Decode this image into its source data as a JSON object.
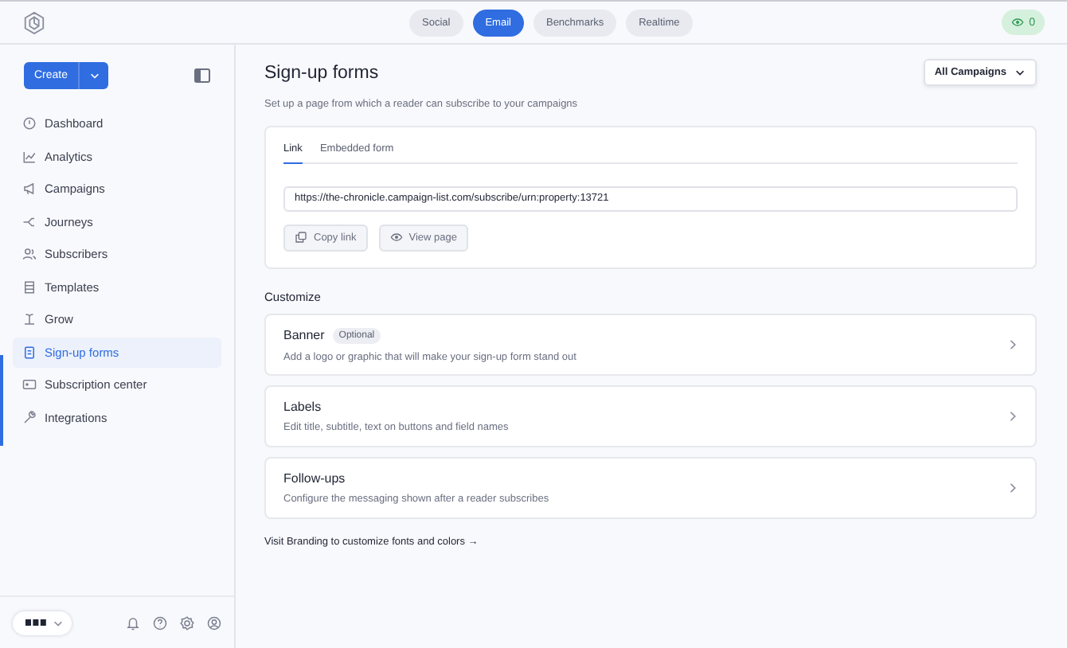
{
  "top_nav": {
    "tabs": [
      {
        "label": "Social",
        "selected": false
      },
      {
        "label": "Email",
        "selected": true
      },
      {
        "label": "Benchmarks",
        "selected": false
      },
      {
        "label": "Realtime",
        "selected": false
      }
    ],
    "views_count": "0"
  },
  "sidebar": {
    "create_button": "Create",
    "items": [
      {
        "label": "Dashboard",
        "selected": false
      },
      {
        "label": "Analytics",
        "selected": false
      },
      {
        "label": "Campaigns",
        "selected": false
      },
      {
        "label": "Journeys",
        "selected": false
      },
      {
        "label": "Subscribers",
        "selected": false
      },
      {
        "label": "Templates",
        "selected": false
      },
      {
        "label": "Grow",
        "selected": false
      },
      {
        "label": "Sign-up forms",
        "selected": true
      },
      {
        "label": "Subscription center",
        "selected": false
      },
      {
        "label": "Integrations",
        "selected": false
      }
    ]
  },
  "main": {
    "title": "Sign-up forms",
    "subtitle": "Set up a page from which a reader can subscribe to your campaigns",
    "filter": "All Campaigns",
    "tabs": [
      {
        "label": "Link",
        "selected": true
      },
      {
        "label": "Embedded form",
        "selected": false
      }
    ],
    "url": "https://the-chronicle.campaign-list.com/subscribe/urn:property:13721",
    "actions": [
      "Copy link",
      "View page"
    ],
    "section_title": "Customize",
    "cards": [
      {
        "title": "Banner",
        "badge": "Optional",
        "description": "Add a logo or graphic that will make your sign-up form stand out"
      },
      {
        "title": "Labels",
        "description": "Edit title, subtitle, text on buttons and field names"
      },
      {
        "title": "Follow-ups",
        "description": "Configure the messaging shown after a reader subscribes"
      }
    ],
    "footer_link": "Visit Branding to customize fonts and colors →"
  }
}
